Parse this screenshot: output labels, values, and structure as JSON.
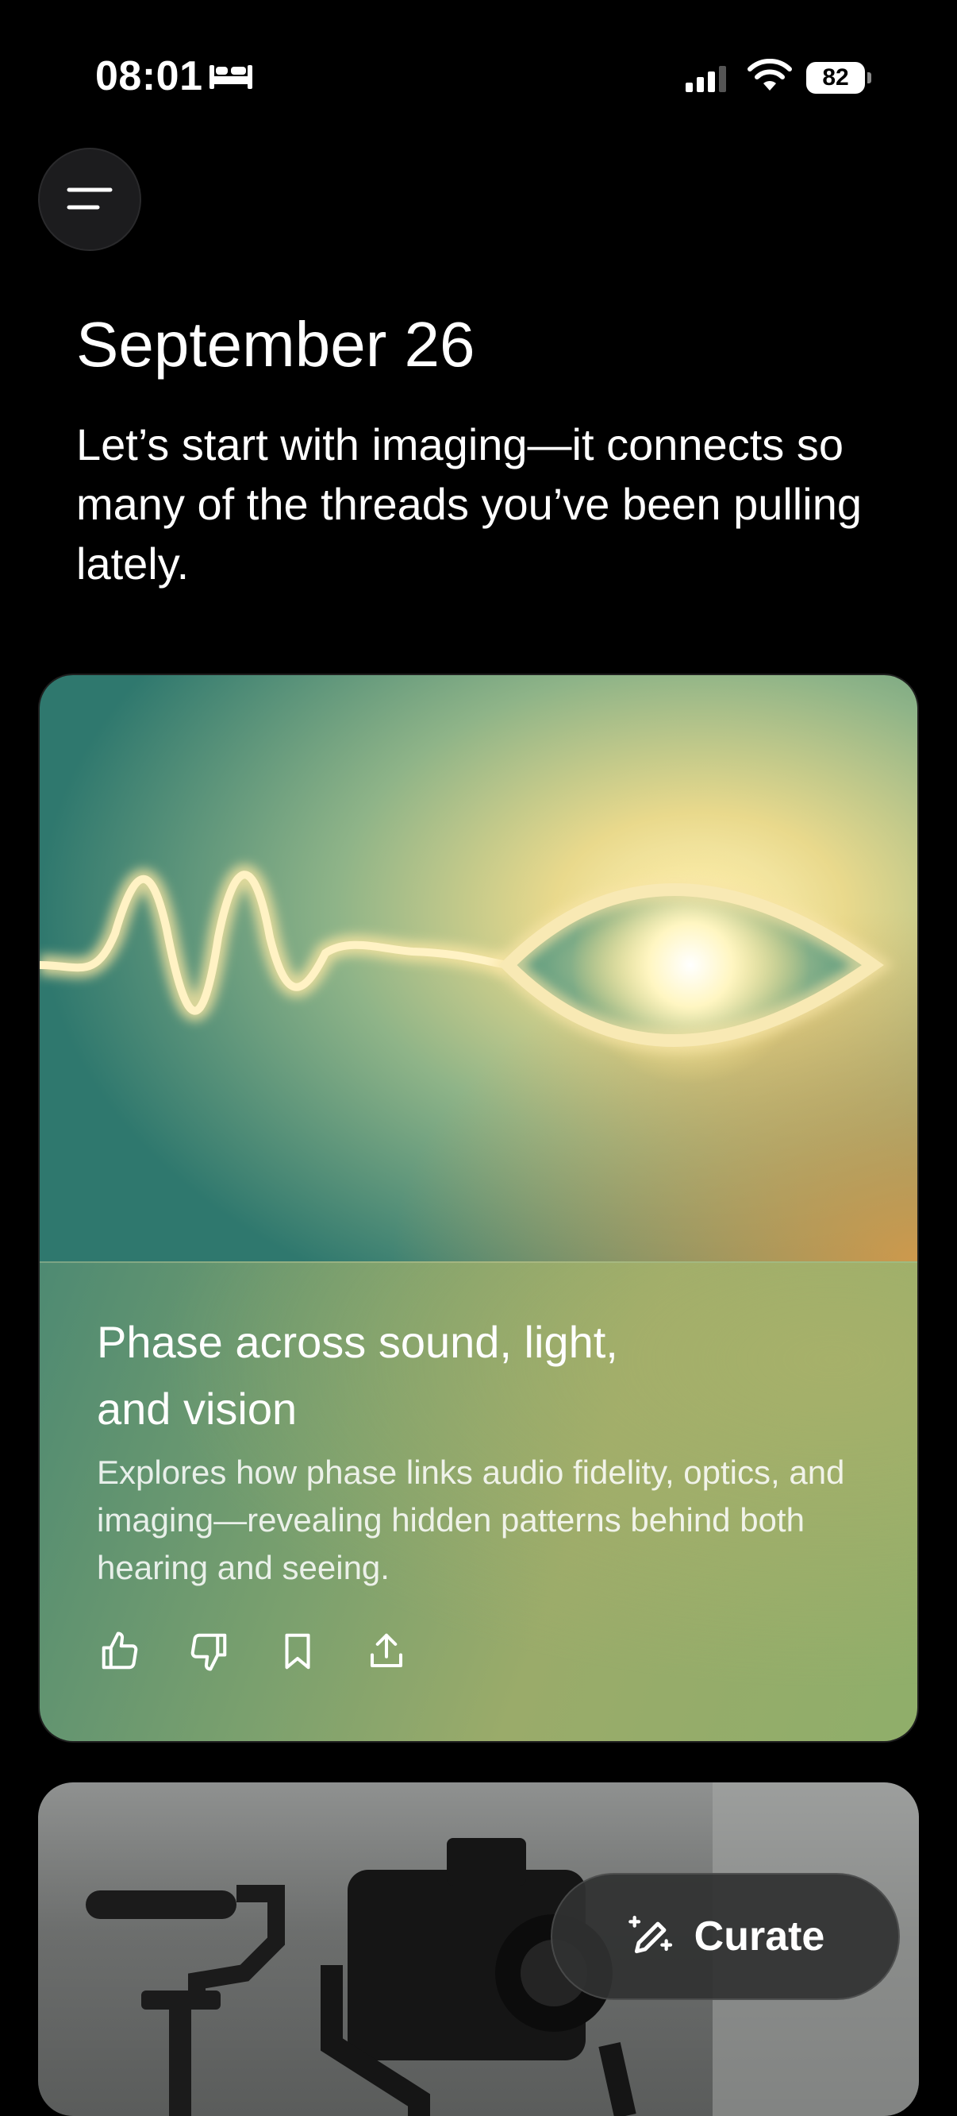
{
  "status_bar": {
    "time": "08:01",
    "sleep_icon": "bed-icon",
    "signal_icon": "cellular-signal-icon",
    "wifi_icon": "wifi-icon",
    "battery": "82"
  },
  "header": {
    "menu_icon": "menu-icon",
    "date": "September 26",
    "intro": "Let’s start with imaging—it connects so many of the threads you’ve been pulling lately."
  },
  "cards": [
    {
      "title": "Phase across sound, light, and vision",
      "description": "Explores how phase links audio fidelity, optics, and imaging—revealing hidden patterns behind both hearing and seeing.",
      "actions": [
        "thumbs-up-icon",
        "thumbs-down-icon",
        "bookmark-icon",
        "share-icon"
      ]
    },
    {
      "image": "camera-gimbal-photo"
    }
  ],
  "curate_button": {
    "label": "Curate",
    "icon": "pencil-sparkle-icon"
  },
  "colors": {
    "background": "#000000",
    "card_teal": "#3f8273",
    "card_gold": "#e6c46a",
    "card_body": "#8fa56b"
  }
}
